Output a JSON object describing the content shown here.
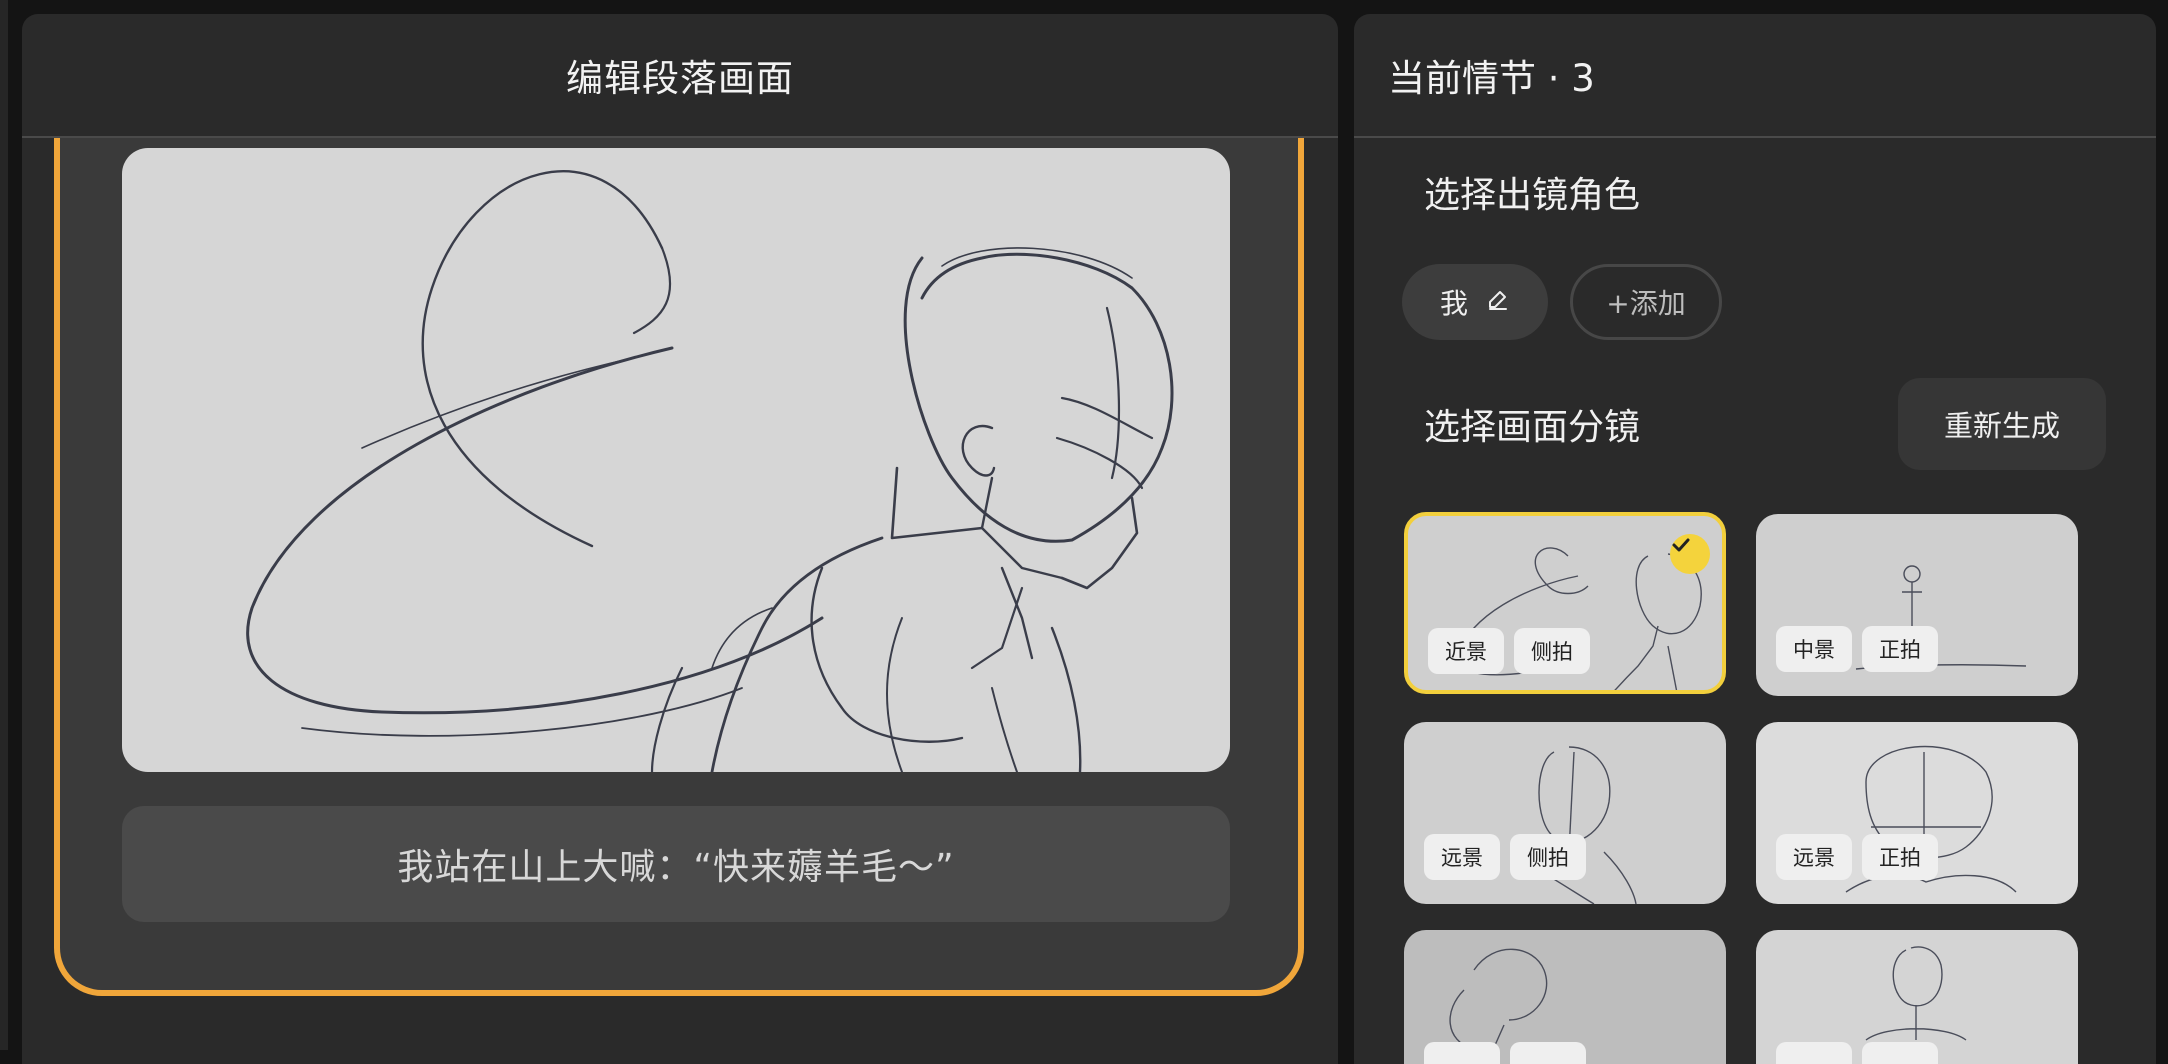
{
  "editor": {
    "title": "编辑段落画面",
    "caption": "我站在山上大喊：“快来薅羊毛～”"
  },
  "side": {
    "title": "当前情节 · 3",
    "roles_title": "选择出镜角色",
    "roles": [
      {
        "name": "我",
        "icon": "pencil-icon"
      }
    ],
    "add_label": "+添加",
    "shots_title": "选择画面分镜",
    "regenerate_label": "重新生成",
    "shots": [
      {
        "tags": [
          "近景",
          "侧拍"
        ],
        "selected": true
      },
      {
        "tags": [
          "中景",
          "正拍"
        ],
        "selected": false
      },
      {
        "tags": [
          "远景",
          "侧拍"
        ],
        "selected": false
      },
      {
        "tags": [
          "远景",
          "正拍"
        ],
        "selected": false
      },
      {
        "tags": [
          "",
          ""
        ],
        "selected": false
      },
      {
        "tags": [
          "",
          ""
        ],
        "selected": false
      }
    ]
  },
  "colors": {
    "accent_border": "#f0a63a",
    "selected_border": "#f2cf3c",
    "panel_bg": "#2a2a2a"
  }
}
